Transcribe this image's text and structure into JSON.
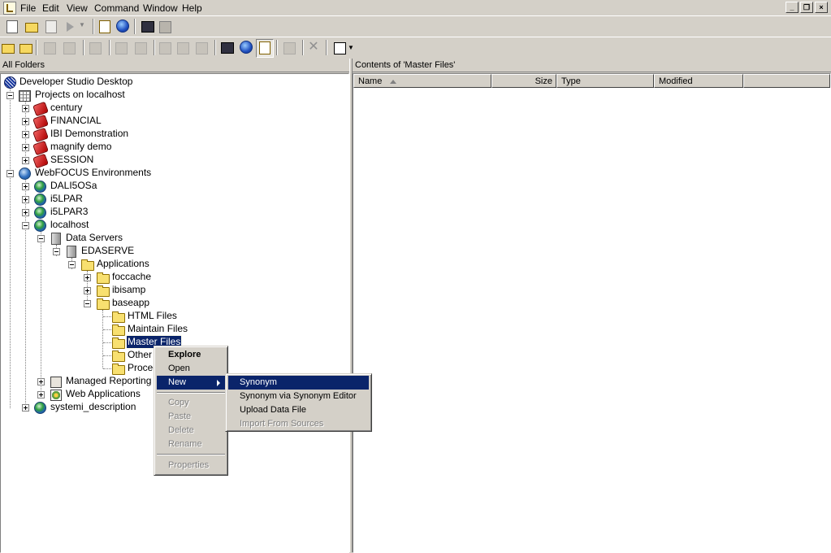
{
  "menubar": {
    "items": [
      "File",
      "Edit",
      "View",
      "Command",
      "Window",
      "Help"
    ]
  },
  "window_controls": {
    "minimize": "_",
    "restore": "❐",
    "close": "×"
  },
  "left_pane": {
    "header": "All Folders"
  },
  "right_pane": {
    "header": "Contents of 'Master Files'",
    "columns": [
      "Name",
      "Size",
      "Type",
      "Modified"
    ]
  },
  "tree": {
    "root": "Developer Studio Desktop",
    "projects": "Projects on localhost",
    "project_items": [
      "century",
      "FINANCIAL",
      "IBI Demonstration",
      "magnify demo",
      "SESSION"
    ],
    "environments": "WebFOCUS Environments",
    "env_items": [
      "DALI5OSa",
      "i5LPAR",
      "i5LPAR3"
    ],
    "localhost": "localhost",
    "data_servers": "Data Servers",
    "edaserve": "EDASERVE",
    "applications": "Applications",
    "apps": [
      "foccache",
      "ibisamp",
      "baseapp"
    ],
    "baseapp_children": [
      "HTML Files",
      "Maintain Files",
      "Master Files",
      "Other",
      "Proced"
    ],
    "managed_reporting": "Managed Reporting",
    "web_applications": "Web Applications",
    "systemi": "systemi_description"
  },
  "context_menu": {
    "items": [
      "Explore",
      "Open",
      "New",
      "Copy",
      "Paste",
      "Delete",
      "Rename",
      "Properties"
    ]
  },
  "submenu": {
    "items": [
      "Synonym",
      "Synonym via Synonym Editor",
      "Upload Data File",
      "Import From Sources"
    ]
  }
}
